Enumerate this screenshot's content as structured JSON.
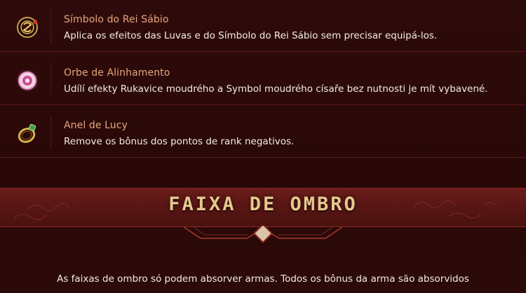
{
  "items": [
    {
      "name": "Símbolo do Rei Sábio",
      "description": "Aplica os efeitos das Luvas e do Símbolo do Rei Sábio sem precisar equipá-los.",
      "icon": "sage-king-symbol-icon"
    },
    {
      "name": "Orbe de Alinhamento",
      "description": "Udílí efekty Rukavice moudrého a Symbol moudrého císaře bez nutnosti je mít vybavené.",
      "icon": "alignment-orb-icon"
    },
    {
      "name": "Anel de Lucy",
      "description": "Remove os bônus dos pontos de rank negativos.",
      "icon": "lucy-ring-icon"
    }
  ],
  "section": {
    "title": "FAIXA DE OMBRO",
    "intro": "As faixas de ombro só podem absorver armas. Todos os bônus da arma são absorvidos"
  },
  "colors": {
    "background": "#2a0909",
    "item_name": "#e6a679",
    "banner": "#581614",
    "banner_title": "#e5c98c"
  }
}
